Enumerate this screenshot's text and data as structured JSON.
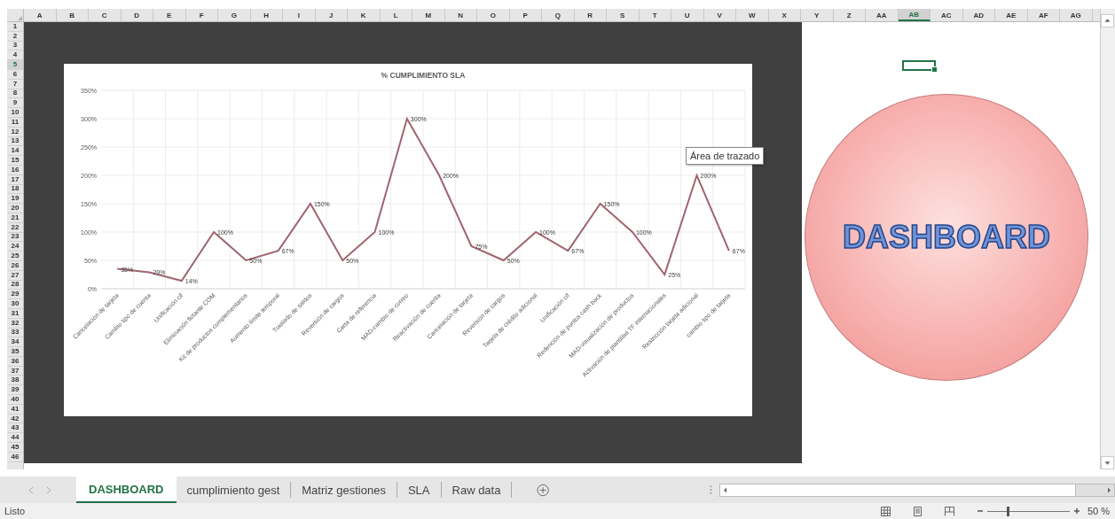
{
  "column_headers": [
    {
      "label": "A",
      "selected": false
    },
    {
      "label": "B",
      "selected": false
    },
    {
      "label": "C",
      "selected": false
    },
    {
      "label": "D",
      "selected": false
    },
    {
      "label": "E",
      "selected": false
    },
    {
      "label": "F",
      "selected": false
    },
    {
      "label": "G",
      "selected": false
    },
    {
      "label": "H",
      "selected": false
    },
    {
      "label": "I",
      "selected": false
    },
    {
      "label": "J",
      "selected": false
    },
    {
      "label": "K",
      "selected": false
    },
    {
      "label": "L",
      "selected": false
    },
    {
      "label": "M",
      "selected": false
    },
    {
      "label": "N",
      "selected": false
    },
    {
      "label": "O",
      "selected": false
    },
    {
      "label": "P",
      "selected": false
    },
    {
      "label": "Q",
      "selected": false
    },
    {
      "label": "R",
      "selected": false
    },
    {
      "label": "S",
      "selected": false
    },
    {
      "label": "T",
      "selected": false
    },
    {
      "label": "U",
      "selected": false
    },
    {
      "label": "V",
      "selected": false
    },
    {
      "label": "W",
      "selected": false
    },
    {
      "label": "X",
      "selected": false
    },
    {
      "label": "Y",
      "selected": false
    },
    {
      "label": "Z",
      "selected": false
    },
    {
      "label": "AA",
      "selected": false
    },
    {
      "label": "AB",
      "selected": true
    },
    {
      "label": "AC",
      "selected": false
    },
    {
      "label": "AD",
      "selected": false
    },
    {
      "label": "AE",
      "selected": false
    },
    {
      "label": "AF",
      "selected": false
    },
    {
      "label": "AG",
      "selected": false
    }
  ],
  "row_headers": [
    {
      "label": "1",
      "selected": false
    },
    {
      "label": "2",
      "selected": false
    },
    {
      "label": "3",
      "selected": false
    },
    {
      "label": "4",
      "selected": false
    },
    {
      "label": "5",
      "selected": true
    },
    {
      "label": "6",
      "selected": false
    },
    {
      "label": "7",
      "selected": false
    },
    {
      "label": "8",
      "selected": false
    },
    {
      "label": "9",
      "selected": false
    },
    {
      "label": "10",
      "selected": false
    },
    {
      "label": "11",
      "selected": false
    },
    {
      "label": "12",
      "selected": false
    },
    {
      "label": "13",
      "selected": false
    },
    {
      "label": "14",
      "selected": false
    },
    {
      "label": "15",
      "selected": false
    },
    {
      "label": "16",
      "selected": false
    },
    {
      "label": "17",
      "selected": false
    },
    {
      "label": "18",
      "selected": false
    },
    {
      "label": "19",
      "selected": false
    },
    {
      "label": "20",
      "selected": false
    },
    {
      "label": "21",
      "selected": false
    },
    {
      "label": "22",
      "selected": false
    },
    {
      "label": "23",
      "selected": false
    },
    {
      "label": "24",
      "selected": false
    },
    {
      "label": "25",
      "selected": false
    },
    {
      "label": "26",
      "selected": false
    },
    {
      "label": "27",
      "selected": false
    },
    {
      "label": "28",
      "selected": false
    },
    {
      "label": "29",
      "selected": false
    },
    {
      "label": "30",
      "selected": false
    },
    {
      "label": "31",
      "selected": false
    },
    {
      "label": "32",
      "selected": false
    },
    {
      "label": "33",
      "selected": false
    },
    {
      "label": "34",
      "selected": false
    },
    {
      "label": "35",
      "selected": false
    },
    {
      "label": "36",
      "selected": false
    },
    {
      "label": "37",
      "selected": false
    },
    {
      "label": "38",
      "selected": false
    },
    {
      "label": "39",
      "selected": false
    },
    {
      "label": "40",
      "selected": false
    },
    {
      "label": "41",
      "selected": false
    },
    {
      "label": "42",
      "selected": false
    },
    {
      "label": "43",
      "selected": false
    },
    {
      "label": "44",
      "selected": false
    },
    {
      "label": "45",
      "selected": false
    },
    {
      "label": "46",
      "selected": false
    }
  ],
  "chart": {
    "tooltip": "Área de trazado",
    "chart_data": {
      "type": "line",
      "title": "% CUMPLIMIENTO SLA",
      "categories": [
        "Cancelación de tarjeta",
        "Cambio tipo de cuenta",
        "Unificación cif",
        "Eliminación flotante COM",
        "Kit de productos complementarios",
        "Aumento límite temporal",
        "Traslado de saldos",
        "Reversión de cargos",
        "Carta de referencia",
        "MAD-cambio de correo",
        "Reactivación de cuenta",
        "Cancelación de tarjeta",
        "Reversión de cargos",
        "Tarjeta de crédito adicional",
        "Unificación cif",
        "Redención de puntos cash back",
        "MAD-visualización de productos",
        "Activación de plantillas TF internacionales",
        "Restricción tarjeta adicional",
        "cambio tipo de tarjeta"
      ],
      "series": [
        {
          "color": "#a0646e",
          "values": [
            35,
            29,
            14,
            100,
            50,
            67,
            150,
            50,
            100,
            300,
            200,
            75,
            50,
            100,
            67,
            150,
            100,
            25,
            200,
            67
          ]
        }
      ],
      "ylim": [
        0,
        350
      ],
      "yticks": [
        {
          "value": 0,
          "label": "0%"
        },
        {
          "value": 50,
          "label": "50%"
        },
        {
          "value": 100,
          "label": "100%"
        },
        {
          "value": 150,
          "label": "150%"
        },
        {
          "value": 200,
          "label": "200%"
        },
        {
          "value": 250,
          "label": "250%"
        },
        {
          "value": 300,
          "label": "300%"
        },
        {
          "value": 350,
          "label": "350%"
        }
      ],
      "grid": true,
      "value_labels": [
        "35%",
        "29%",
        "14%",
        "100%",
        "50%",
        "67%",
        "150%",
        "50%",
        "100%",
        "300%",
        "200%",
        "75%",
        "50%",
        "100%",
        "67%",
        "150%",
        "100%",
        "25%",
        "200%",
        "67%"
      ]
    }
  },
  "shape_text": "DASHBOARD",
  "sheet_tabs": [
    {
      "label": "DASHBOARD",
      "selected": true
    },
    {
      "label": "cumplimiento gest",
      "selected": false
    },
    {
      "label": "Matriz gestiones",
      "selected": false
    },
    {
      "label": "SLA",
      "selected": false
    },
    {
      "label": "Raw data",
      "selected": false
    }
  ],
  "status_bar": {
    "text": "Listo",
    "zoom_slider": {
      "level": 0.25
    },
    "zoom": "50 %"
  }
}
